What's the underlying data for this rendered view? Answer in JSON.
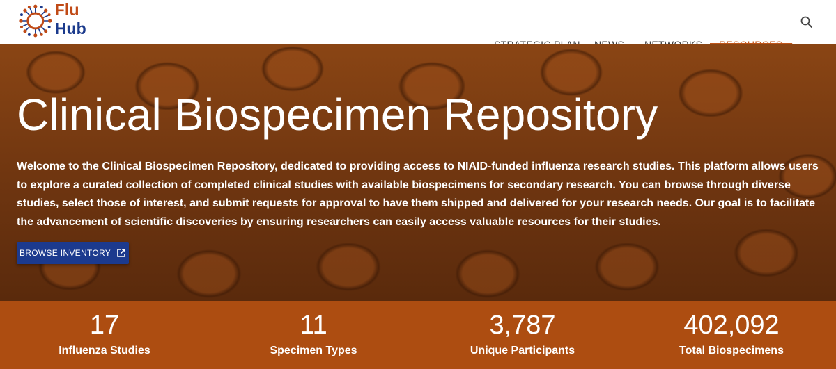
{
  "brand": {
    "name_part1": "Flu",
    "name_part2": "Hub",
    "colors": {
      "orange": "#c04a16",
      "navy": "#1b3a8c"
    }
  },
  "nav": {
    "items": [
      {
        "label": "STRATEGIC PLAN"
      },
      {
        "label": "NEWS"
      },
      {
        "label": "NETWORKS"
      },
      {
        "label": "RESOURCES",
        "active": true,
        "has_dropdown": true
      }
    ],
    "search_icon": "search-icon"
  },
  "hero": {
    "title": "Clinical Biospecimen Repository",
    "description": "Welcome to the Clinical Biospecimen Repository, dedicated to providing access to NIAID-funded influenza research studies. This platform allows users to explore a curated collection of completed clinical studies with available biospecimens for secondary research. You can browse through diverse studies, select those of interest, and submit requests for approval to have them shipped and delivered for your research needs. Our goal is to facilitate the advancement of scientific discoveries by ensuring researchers can easily access valuable resources for their studies.",
    "button_label": "BROWSE INVENTORY",
    "button_icon": "external-link-icon"
  },
  "stats": [
    {
      "value": "17",
      "label": "Influenza Studies"
    },
    {
      "value": "11",
      "label": "Specimen Types"
    },
    {
      "value": "3,787",
      "label": "Unique Participants"
    },
    {
      "value": "402,092",
      "label": "Total Biospecimens"
    }
  ],
  "colors": {
    "accent": "#c0561b",
    "button": "#1c3a8e",
    "stats_band": "#ad4d11"
  }
}
